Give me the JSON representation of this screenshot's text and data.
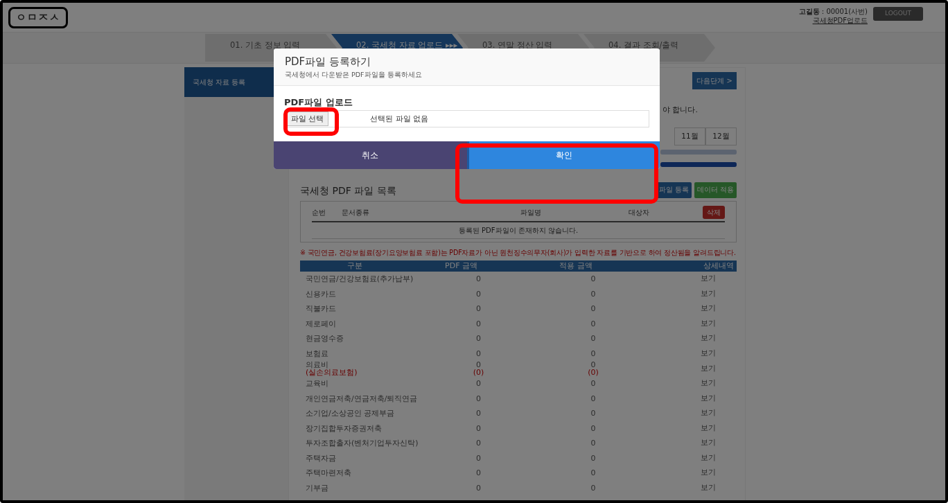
{
  "header": {
    "logo": "ㅇㅁㅈㅅ",
    "user_name": "고길동",
    "separator": ":",
    "employee_id": "00001(사번)",
    "page_link": "국세청PDF업로드",
    "logout": "LOGOUT"
  },
  "steps": [
    {
      "label": "01. 기초 정보 입력",
      "selected": false
    },
    {
      "label": "02. 국세청 자료 업로드 ▸▸▸",
      "selected": true
    },
    {
      "label": "03. 연말 정산 입력",
      "selected": false
    },
    {
      "label": "04. 결과 조회/출력",
      "selected": false
    }
  ],
  "sidebar": {
    "items": [
      {
        "label": "국세청 자료 등록",
        "selected": true
      }
    ]
  },
  "main": {
    "next_button": "다음단계 >",
    "notice_fragment": "야 합니다.",
    "months": [
      "11월",
      "12월"
    ],
    "progress": [
      {
        "level": 1
      },
      {
        "level": 1
      }
    ],
    "file_list": {
      "title": "국세청 PDF 파일 목록",
      "register_button": "파일 등록",
      "apply_button": "데이터 적용",
      "columns": [
        "순번",
        "문서종류",
        "파일명",
        "대상자"
      ],
      "delete_button": "삭제",
      "empty_message": "등록된 PDF파일이 존재하지 않습니다."
    },
    "warning": "※ 국민연금, 건강보험료(장기요양보험료 포함)는 PDF자료가 아닌 원천징수의무자(회사)가 입력한 자료를 기반으로 하여 정산됨을 알려드립니다.",
    "amounts": {
      "columns": [
        "구분",
        "PDF 금액",
        "적용 금액",
        "상세내역"
      ],
      "rows": [
        {
          "label": "국민연금/건강보험료(추가납부)",
          "pdf": "0",
          "applied": "0",
          "detail": "보기"
        },
        {
          "label": "신용카드",
          "pdf": "0",
          "applied": "0",
          "detail": "보기"
        },
        {
          "label": "직불카드",
          "pdf": "0",
          "applied": "0",
          "detail": "보기"
        },
        {
          "label": "제로페이",
          "pdf": "0",
          "applied": "0",
          "detail": "보기"
        },
        {
          "label": "현금영수증",
          "pdf": "0",
          "applied": "0",
          "detail": "보기"
        },
        {
          "label": "보험료",
          "pdf": "0",
          "applied": "0",
          "detail": "보기"
        },
        {
          "label": "의료비",
          "pdf": "0",
          "applied": "0",
          "detail": "보기",
          "sub": {
            "label": "(실손의료보험)",
            "pdf": "(0)",
            "applied": "(0)"
          }
        },
        {
          "label": "교육비",
          "pdf": "0",
          "applied": "0",
          "detail": "보기"
        },
        {
          "label": "개인연금저축/연금저축/퇴직연금",
          "pdf": "0",
          "applied": "0",
          "detail": "보기"
        },
        {
          "label": "소기업/소상공인 공제부금",
          "pdf": "0",
          "applied": "0",
          "detail": "보기"
        },
        {
          "label": "장기집합투자증권저축",
          "pdf": "0",
          "applied": "0",
          "detail": "보기"
        },
        {
          "label": "투자조합출자(벤처기업투자신탁)",
          "pdf": "0",
          "applied": "0",
          "detail": "보기"
        },
        {
          "label": "주택자금",
          "pdf": "0",
          "applied": "0",
          "detail": "보기"
        },
        {
          "label": "주택마련저축",
          "pdf": "0",
          "applied": "0",
          "detail": "보기"
        },
        {
          "label": "기부금",
          "pdf": "0",
          "applied": "0",
          "detail": "보기"
        }
      ]
    }
  },
  "modal": {
    "title": "PDF파일 등록하기",
    "subtitle": "국세청에서 다운받은 PDF파일을 등록하세요",
    "section_label": "PDF파일 업로드",
    "file_button": "파일 선택",
    "file_status": "선택된 파일 없음",
    "cancel": "취소",
    "confirm": "확인"
  }
}
